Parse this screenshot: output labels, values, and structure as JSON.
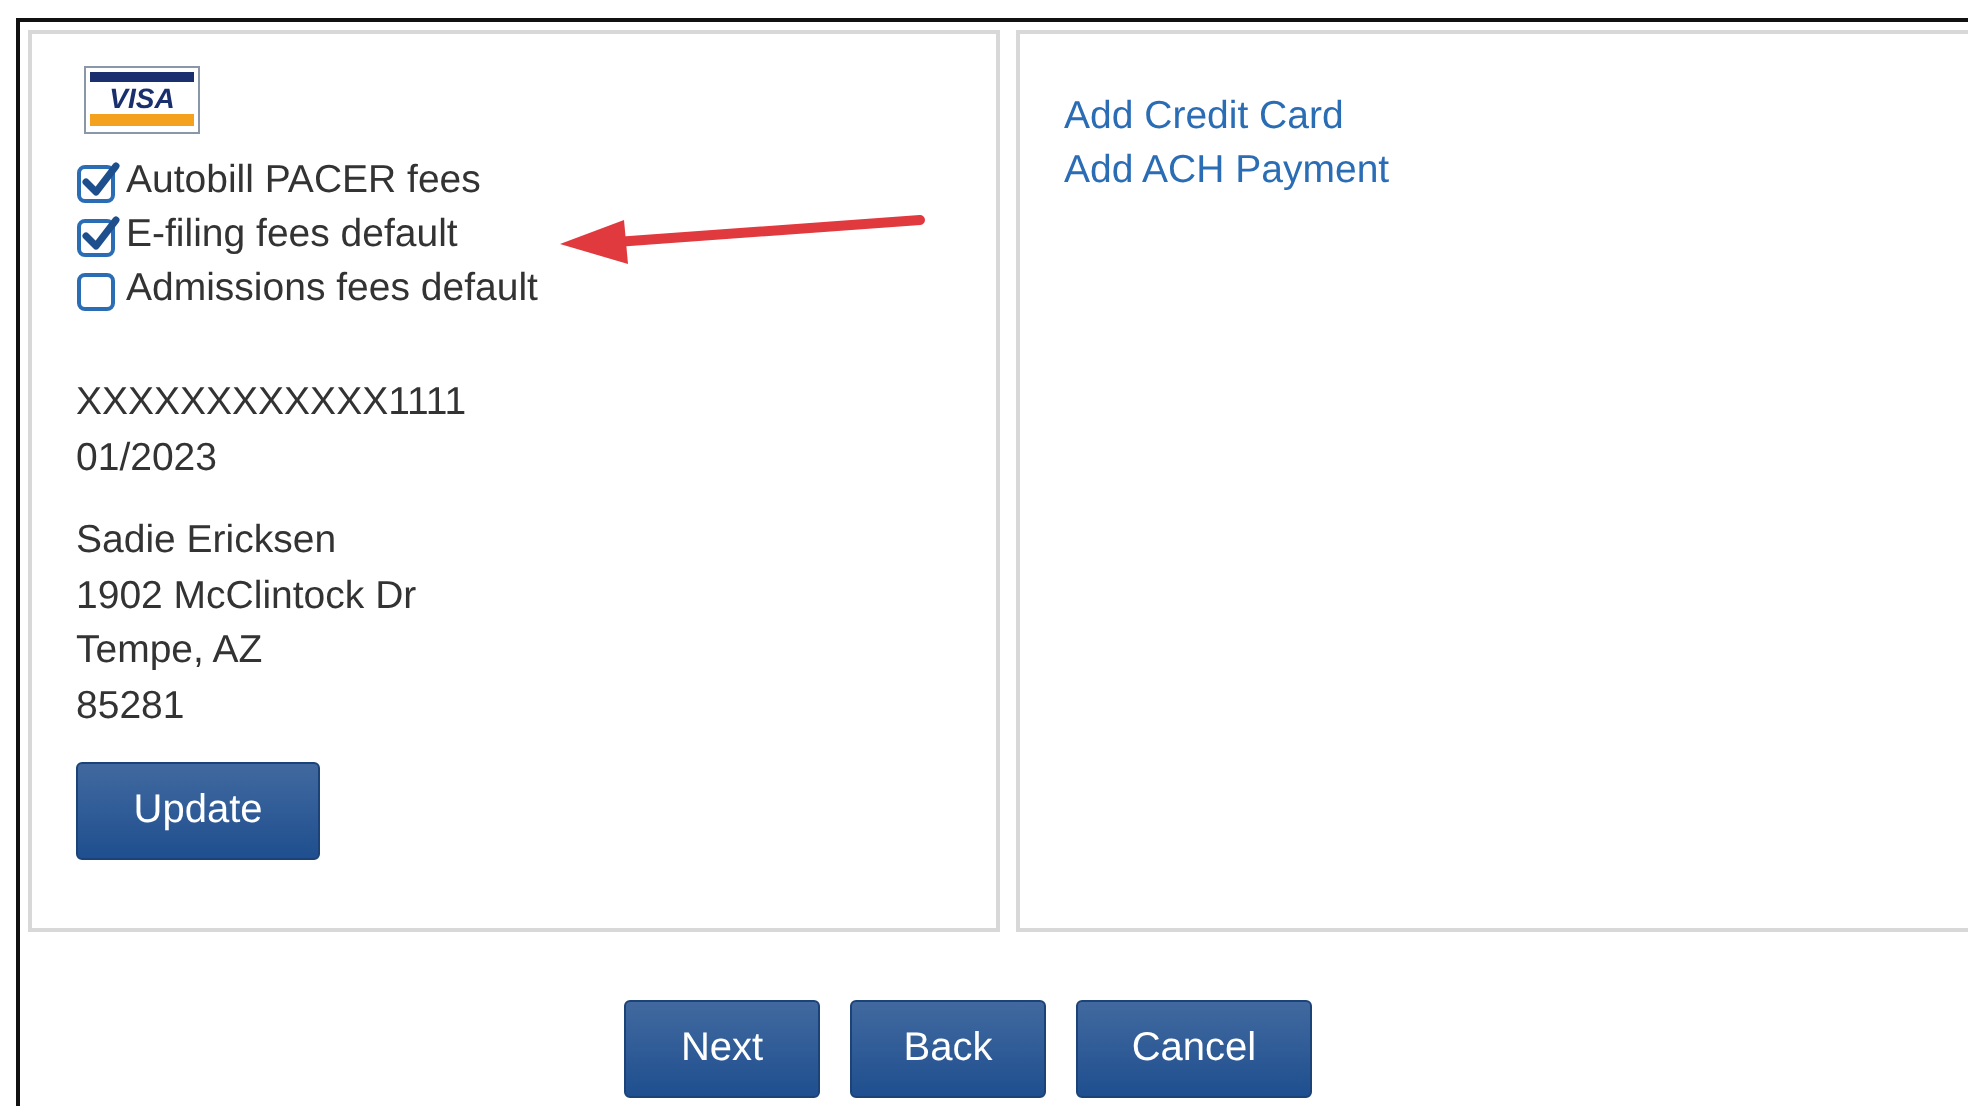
{
  "card": {
    "brand": "VISA",
    "options": [
      {
        "label": "Autobill PACER fees",
        "checked": true
      },
      {
        "label": "E-filing fees default",
        "checked": true
      },
      {
        "label": "Admissions fees default",
        "checked": false
      }
    ],
    "number": "XXXXXXXXXXXX1111",
    "expiry": "01/2023",
    "address": [
      "Sadie Ericksen",
      "1902 McClintock Dr",
      "Tempe, AZ",
      "85281"
    ],
    "button": "Update"
  },
  "links": [
    "Add Credit Card",
    "Add ACH Payment"
  ],
  "buttons": [
    "Next",
    "Back",
    "Cancel"
  ]
}
